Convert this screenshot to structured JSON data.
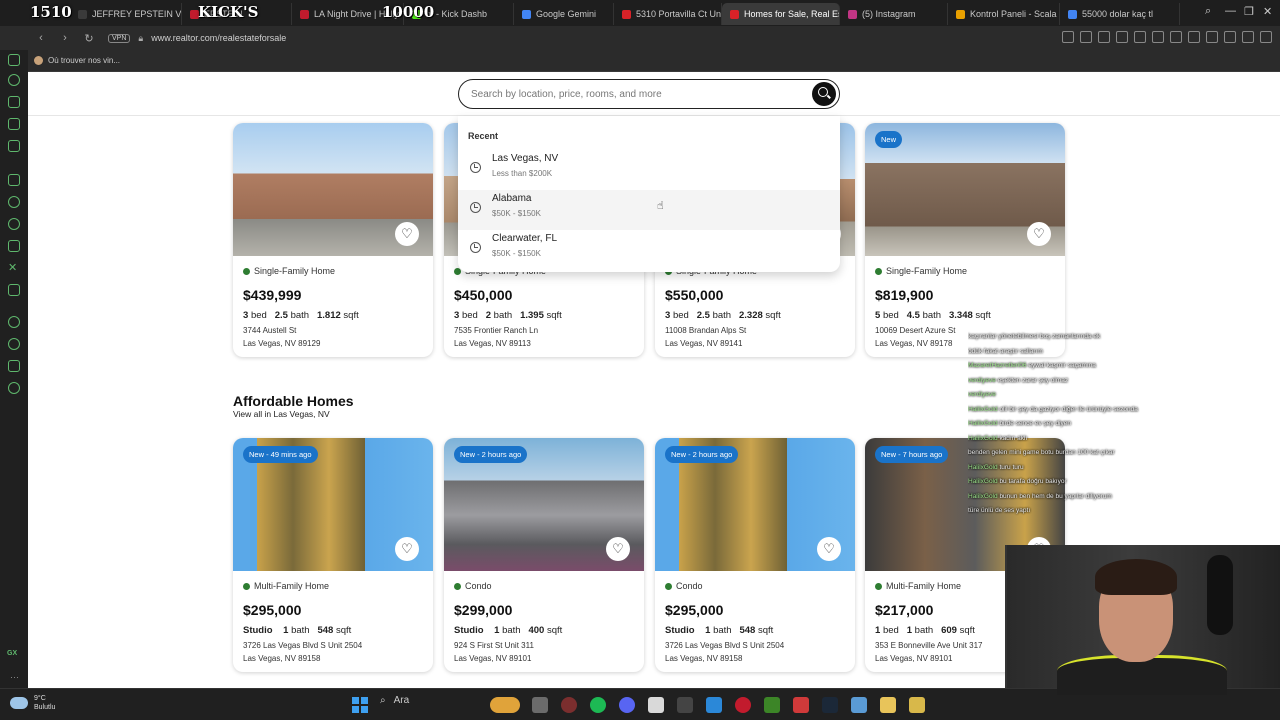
{
  "browser": {
    "tabs": [
      {
        "label": "JEFFREY EPSTEIN V",
        "color": "#3a3a3a",
        "active": false
      },
      {
        "label": "EPSTEIN",
        "color": "#c21b2d",
        "active": false
      },
      {
        "label": "LA Night Drive | Holly",
        "color": "#c21b2d",
        "active": false
      },
      {
        "label": "m - Kick Dashb",
        "color": "#53fc18",
        "active": false
      },
      {
        "label": "Google Gemini",
        "color": "#4285f4",
        "active": false
      },
      {
        "label": "5310 Portavilla Ct Un",
        "color": "#d92228",
        "active": false
      },
      {
        "label": "Homes for Sale, Real Esta",
        "color": "#d92228",
        "active": true
      },
      {
        "label": "(5) Instagram",
        "color": "#c13584",
        "active": false
      },
      {
        "label": "Kontrol Paneli - Scala",
        "color": "#e8a000",
        "active": false
      },
      {
        "label": "55000 dolar kaç tl",
        "color": "#4285f4",
        "active": false
      }
    ],
    "overlay_counter_1": "1510",
    "overlay_title": "KICK'S",
    "overlay_counter_2": "10000",
    "url": "www.realtor.com/realestateforsale",
    "vpn_label": "VPN",
    "bookmark_label": "Où trouver nos vin..."
  },
  "search": {
    "placeholder": "Search by location, price, rooms, and more",
    "recent_heading": "Recent",
    "recent": [
      {
        "title": "Las Vegas, NV",
        "subtitle": "Less than $200K"
      },
      {
        "title": "Alabama",
        "subtitle": "$50K - $150K"
      },
      {
        "title": "Clearwater, FL",
        "subtitle": "$50K - $150K"
      }
    ]
  },
  "listings_top": [
    {
      "type": "Single-Family Home",
      "price": "$439,999",
      "bed": "3",
      "bed_label": "bed",
      "bath": "2.5",
      "bath_label": "bath",
      "sqft": "1.812",
      "sqft_label": "sqft",
      "addr1": "3744 Austell St",
      "addr2": "Las Vegas, NV 89129",
      "badge": ""
    },
    {
      "type": "Single-Family Home",
      "price": "$450,000",
      "bed": "3",
      "bed_label": "bed",
      "bath": "2",
      "bath_label": "bath",
      "sqft": "1.395",
      "sqft_label": "sqft",
      "addr1": "7535 Frontier Ranch Ln",
      "addr2": "Las Vegas, NV 89113",
      "badge": ""
    },
    {
      "type": "Single-Family Home",
      "price": "$550,000",
      "bed": "3",
      "bed_label": "bed",
      "bath": "2.5",
      "bath_label": "bath",
      "sqft": "2.328",
      "sqft_label": "sqft",
      "addr1": "11008 Brandan Alps St",
      "addr2": "Las Vegas, NV 89141",
      "badge": ""
    },
    {
      "type": "Single-Family Home",
      "price": "$819,900",
      "bed": "5",
      "bed_label": "bed",
      "bath": "4.5",
      "bath_label": "bath",
      "sqft": "3.348",
      "sqft_label": "sqft",
      "addr1": "10069 Desert Azure St",
      "addr2": "Las Vegas, NV 89178",
      "badge": "New"
    }
  ],
  "section": {
    "title": "Affordable Homes",
    "link": "View all in Las Vegas, NV"
  },
  "listings_affordable": [
    {
      "type": "Multi-Family Home",
      "price": "$295,000",
      "bed": "Studio",
      "bed_label": "",
      "bath": "1",
      "bath_label": "bath",
      "sqft": "548",
      "sqft_label": "sqft",
      "addr1": "3726 Las Vegas Blvd S Unit 2504",
      "addr2": "Las Vegas, NV 89158",
      "badge": "New - 49 mins ago"
    },
    {
      "type": "Condo",
      "price": "$299,000",
      "bed": "Studio",
      "bed_label": "",
      "bath": "1",
      "bath_label": "bath",
      "sqft": "400",
      "sqft_label": "sqft",
      "addr1": "924 S First St Unit 311",
      "addr2": "Las Vegas, NV 89101",
      "badge": "New - 2 hours ago"
    },
    {
      "type": "Condo",
      "price": "$295,000",
      "bed": "Studio",
      "bed_label": "",
      "bath": "1",
      "bath_label": "bath",
      "sqft": "548",
      "sqft_label": "sqft",
      "addr1": "3726 Las Vegas Blvd S Unit 2504",
      "addr2": "Las Vegas, NV 89158",
      "badge": "New - 2 hours ago"
    },
    {
      "type": "Multi-Family Home",
      "price": "$217,000",
      "bed": "1",
      "bed_label": "bed",
      "bath": "1",
      "bath_label": "bath",
      "sqft": "609",
      "sqft_label": "sqft",
      "addr1": "353 E Bonneville Ave Unit 317",
      "addr2": "Las Vegas, NV 89101",
      "badge": "New - 7 hours ago"
    }
  ],
  "chat": [
    {
      "user": "",
      "msg": "kaçıranlar yönetebilmesi boş zamanlarında ek"
    },
    {
      "user": "",
      "msg": "ödük fakat araştır sallarım"
    },
    {
      "user": "MazaretHazretleri06",
      "msg": "eywal kaşmir saçamına"
    },
    {
      "user": "verdiyeve",
      "msg": "eşekten zarar şey olmaz"
    },
    {
      "user": "verdiyeve",
      "msg": ""
    },
    {
      "user": "HalilxGold",
      "msg": "olil bir şey da gaziyor diğer ile ürünüyle sezonda"
    },
    {
      "user": "HalilxGold",
      "msg": "birde sence ev şey diyen"
    },
    {
      "user": "HalilxGold",
      "msg": "kadın aklı"
    },
    {
      "user": "",
      "msg": "benden gelen mini game botu burdan 100 kat çıkar"
    },
    {
      "user": "HalilxGold",
      "msg": "turu turu"
    },
    {
      "user": "HalilxGold",
      "msg": "bu tarafa doğru bakıyor"
    },
    {
      "user": "HalilxGold",
      "msg": "bunun ben hem de bu yapılar diliyorum"
    },
    {
      "user": "",
      "msg": ""
    },
    {
      "user": "",
      "msg": "türe ünlü de ses yaptı"
    }
  ],
  "taskbar": {
    "temp": "9°C",
    "weather": "Bulutlu",
    "search_label": "Ara"
  },
  "colors": {
    "accent": "#d92228",
    "badge_blue": "#1a73c9",
    "status_green": "#2e7d32",
    "kick_green": "#53fc18"
  }
}
